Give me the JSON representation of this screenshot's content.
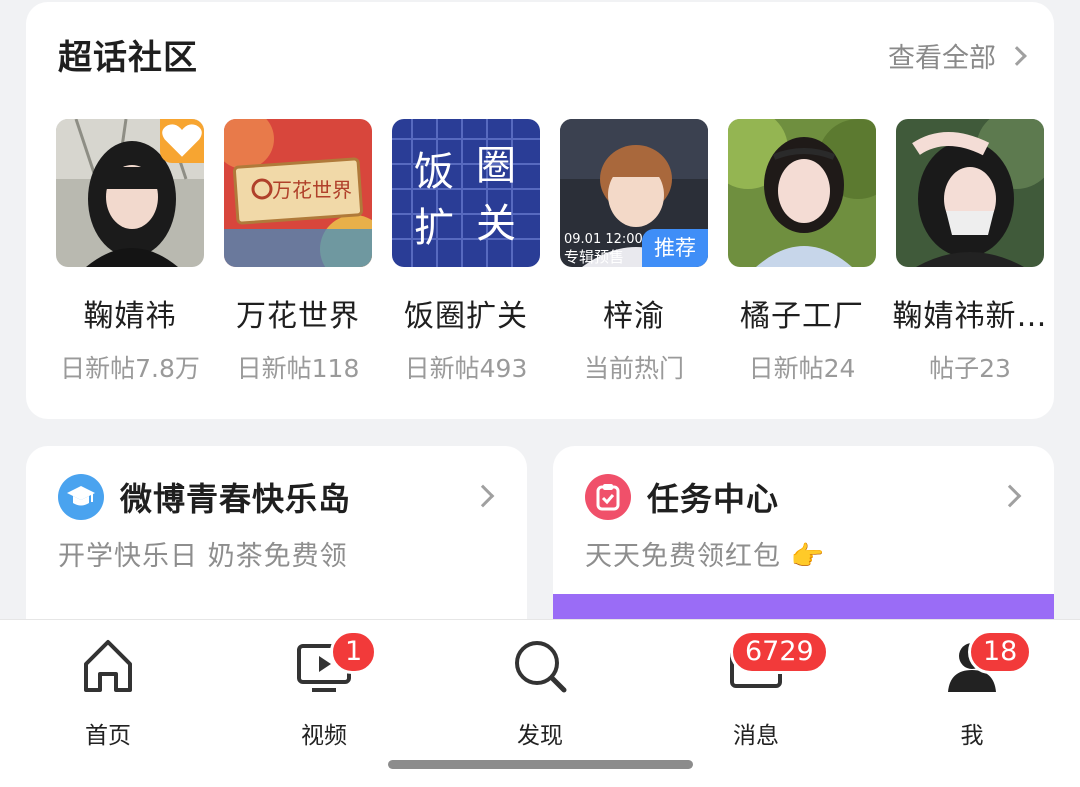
{
  "super_topic": {
    "title": "超话社区",
    "view_all": "查看全部",
    "items": [
      {
        "name": "鞠婧祎",
        "meta": "日新帖7.8万"
      },
      {
        "name": "万花世界",
        "meta": "日新帖118",
        "thumb_text": "万花世界"
      },
      {
        "name": "饭圈扩关",
        "meta": "日新帖493",
        "thumb_text": [
          "饭",
          "圈",
          "扩",
          "关"
        ]
      },
      {
        "name": "梓渝",
        "meta": "当前热门",
        "badge": "推荐",
        "thumb_text": [
          "09.01 12:00",
          "专辑预售"
        ]
      },
      {
        "name": "橘子工厂",
        "meta": "日新帖24"
      },
      {
        "name": "鞠婧祎新…",
        "meta": "帖子23"
      }
    ]
  },
  "cards": {
    "left": {
      "title": "微博青春快乐岛",
      "subtitle": "开学快乐日 奶茶免费领",
      "icon": "graduation-cap-icon",
      "color": "#4aa3ef"
    },
    "right": {
      "title": "任务中心",
      "subtitle": "天天免费领红包 👉",
      "icon": "clipboard-check-icon",
      "color": "#f0506a"
    }
  },
  "tabbar": {
    "items": [
      {
        "label": "首页",
        "icon": "home-icon"
      },
      {
        "label": "视频",
        "icon": "tv-play-icon",
        "badge": "1"
      },
      {
        "label": "发现",
        "icon": "search-icon"
      },
      {
        "label": "消息",
        "icon": "mail-icon",
        "badge": "6729"
      },
      {
        "label": "我",
        "icon": "user-icon",
        "badge": "18"
      }
    ]
  },
  "colors": {
    "accent_blue": "#3f8ef7",
    "badge_red": "#f23a3a",
    "purple": "#9a6cf6"
  }
}
